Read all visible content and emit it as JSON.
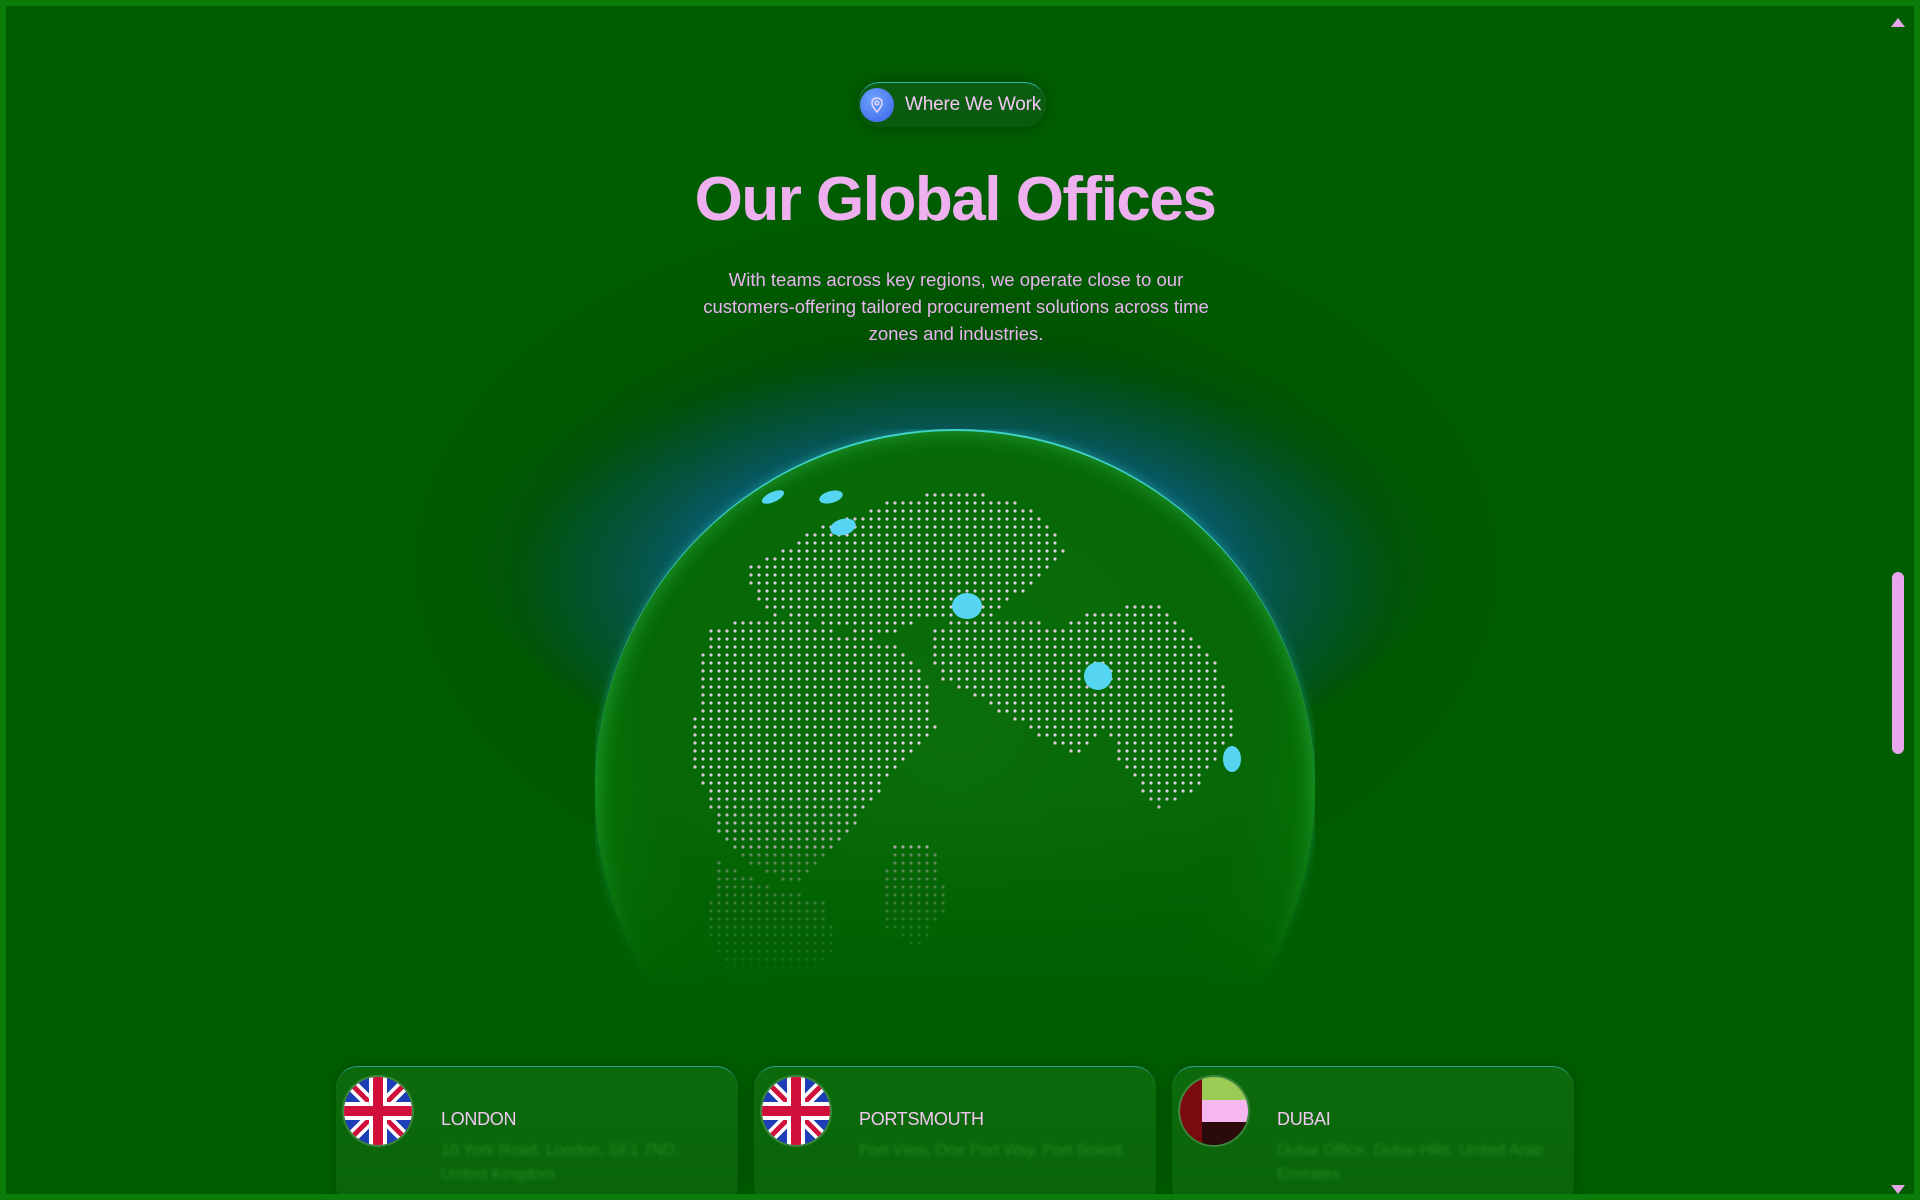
{
  "badge": {
    "label": "Where We Work",
    "icon": "location-pin-icon"
  },
  "heading": {
    "title": "Our Global Offices"
  },
  "intro": {
    "text": "With teams across key regions, we operate close to our customers-offering tailored procurement solutions across time zones and industries."
  },
  "globe": {
    "icon": "dotted-earth-globe",
    "marker_color": "#56d5f2",
    "dot_color": "#f6d3f6"
  },
  "offices": [
    {
      "city": "LONDON",
      "flag": "uk-flag-icon",
      "address": "10 York Road, London, SE1 7ND, United Kingdom"
    },
    {
      "city": "PORTSMOUTH",
      "flag": "uk-flag-icon",
      "address": "Port View, One Port Way, Port Solent"
    },
    {
      "city": "DUBAI",
      "flag": "uae-flag-icon",
      "address": "Dubai Office, Dubai Hills, United Arab Emirates"
    }
  ],
  "colors": {
    "background": "#005e00",
    "title": "#efb0ef",
    "glow": "#0c8fd6",
    "scroll_thumb": "#e9a7ee"
  }
}
